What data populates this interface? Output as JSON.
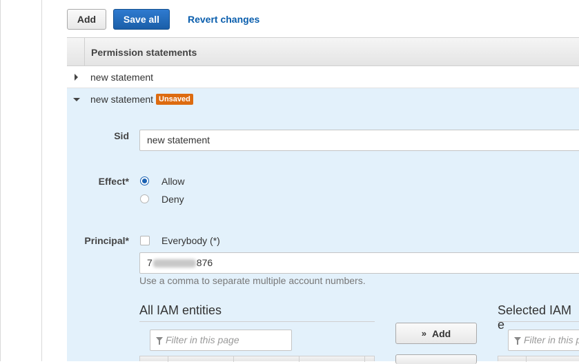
{
  "toolbar": {
    "add_label": "Add",
    "save_all_label": "Save all",
    "revert_label": "Revert changes"
  },
  "table": {
    "header": "Permission statements",
    "rows": [
      {
        "label": "new statement",
        "expanded": false
      },
      {
        "label": "new statement",
        "expanded": true,
        "badge": "Unsaved"
      }
    ]
  },
  "form": {
    "sid": {
      "label": "Sid",
      "value": "new statement"
    },
    "effect": {
      "label": "Effect*",
      "options": [
        {
          "label": "Allow",
          "selected": true
        },
        {
          "label": "Deny",
          "selected": false
        }
      ]
    },
    "principal": {
      "label": "Principal*",
      "everybody_label": "Everybody (*)",
      "everybody_checked": false,
      "account_prefix": "7",
      "account_suffix": "876",
      "hint": "Use a comma to separate multiple account numbers."
    }
  },
  "iam": {
    "all_title": "All IAM entities",
    "selected_title": "Selected IAM e",
    "filter_placeholder": "Filter in this page",
    "filter_placeholder_right": "Filter in this p",
    "add_label": "Add"
  },
  "colors": {
    "primary": "#1a5ea8",
    "link": "#0a5ead",
    "badge": "#dd6b10",
    "panel": "#e3f1fb"
  }
}
